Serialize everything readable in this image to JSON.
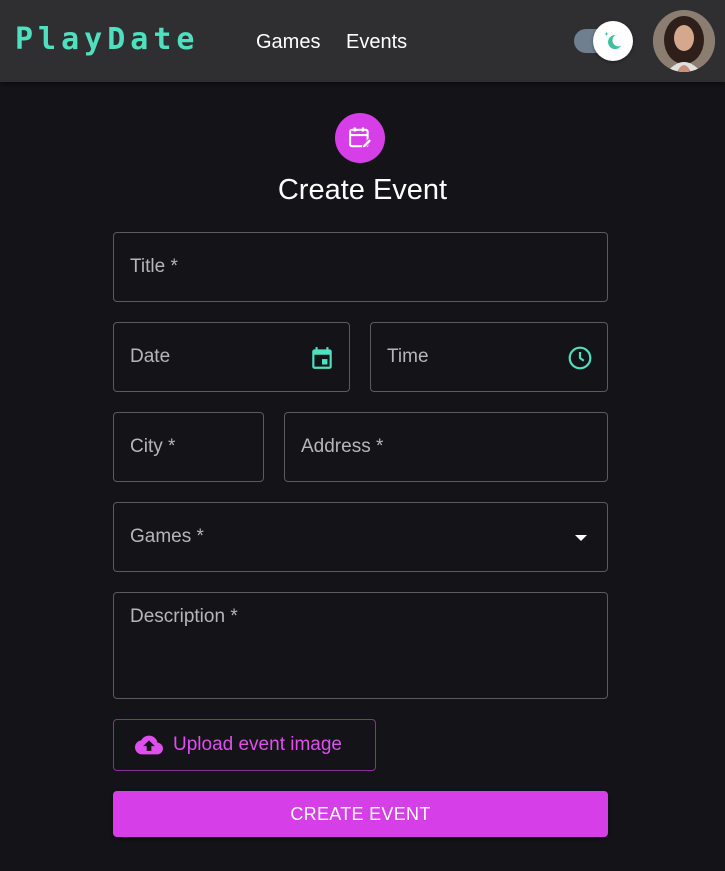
{
  "header": {
    "logo": "PlayDate",
    "nav": [
      {
        "label": "Games"
      },
      {
        "label": "Events"
      }
    ],
    "theme_toggle_icon": "moon-sparkle-icon",
    "avatar_icon": "user-avatar"
  },
  "form": {
    "icon": "calendar-edit-icon",
    "title": "Create Event",
    "fields": {
      "title": {
        "label": "Title *",
        "value": ""
      },
      "date": {
        "label": "Date",
        "value": "",
        "icon": "calendar-icon"
      },
      "time": {
        "label": "Time",
        "value": "",
        "icon": "clock-icon"
      },
      "city": {
        "label": "City *",
        "value": ""
      },
      "address": {
        "label": "Address *",
        "value": ""
      },
      "games": {
        "label": "Games *",
        "value": "",
        "icon": "dropdown-arrow-icon"
      },
      "description": {
        "label": "Description *",
        "value": ""
      }
    },
    "upload_label": "Upload event image",
    "upload_icon": "cloud-upload-icon",
    "submit_label": "CREATE EVENT"
  },
  "colors": {
    "background": "#141318",
    "appbar": "#2f2f31",
    "accent": "#d63ee8",
    "logo": "#4fe0bf",
    "icon_teal": "#4fe0bf",
    "field_border": "#5a5a60"
  }
}
